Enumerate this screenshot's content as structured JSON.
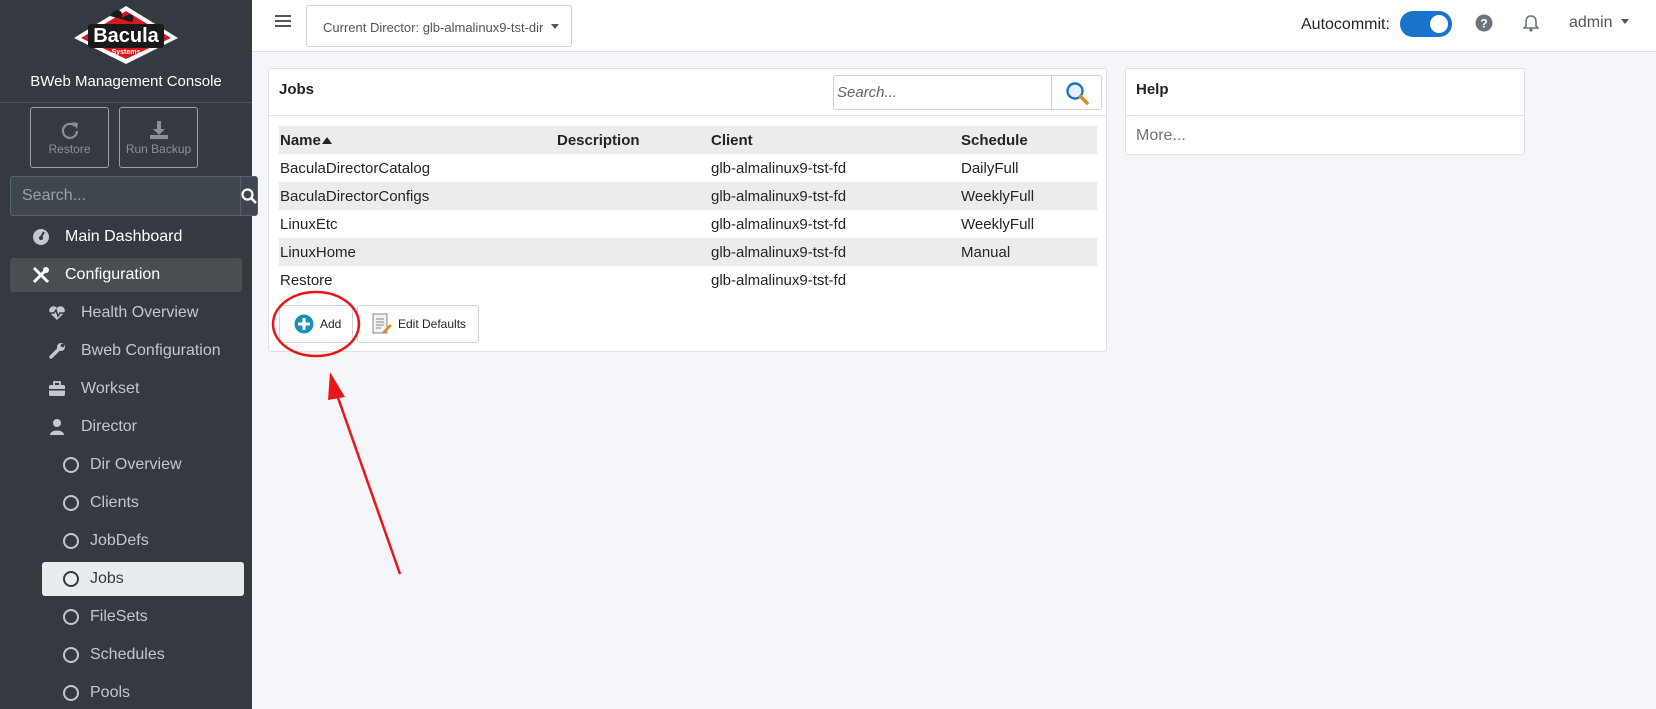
{
  "sidebar": {
    "logo_text": "Bacula",
    "logo_subtext": "Systems",
    "brand_title": "BWeb Management Console",
    "actions": [
      {
        "label": "Restore",
        "icon": "redo-icon"
      },
      {
        "label": "Run Backup",
        "icon": "download-icon"
      }
    ],
    "search_placeholder": "Search...",
    "nav": {
      "main_dashboard": "Main Dashboard",
      "configuration": "Configuration",
      "health_overview": "Health Overview",
      "bweb_configuration": "Bweb Configuration",
      "workset": "Workset",
      "director": "Director",
      "dir_overview": "Dir Overview",
      "clients": "Clients",
      "jobdefs": "JobDefs",
      "jobs": "Jobs",
      "filesets": "FileSets",
      "schedules": "Schedules",
      "pools": "Pools"
    }
  },
  "header": {
    "director_label": "Current Director: glb-almalinux9-tst-dir",
    "autocommit_label": "Autocommit:",
    "autocommit_on": true,
    "user": "admin"
  },
  "jobs_card": {
    "title": "Jobs",
    "search_placeholder": "Search...",
    "columns": [
      "Name",
      "Description",
      "Client",
      "Schedule"
    ],
    "rows": [
      {
        "name": "BaculaDirectorCatalog",
        "description": "",
        "client": "glb-almalinux9-tst-fd",
        "schedule": "DailyFull"
      },
      {
        "name": "BaculaDirectorConfigs",
        "description": "",
        "client": "glb-almalinux9-tst-fd",
        "schedule": "WeeklyFull"
      },
      {
        "name": "LinuxEtc",
        "description": "",
        "client": "glb-almalinux9-tst-fd",
        "schedule": "WeeklyFull"
      },
      {
        "name": "LinuxHome",
        "description": "",
        "client": "glb-almalinux9-tst-fd",
        "schedule": "Manual"
      },
      {
        "name": "Restore",
        "description": "",
        "client": "glb-almalinux9-tst-fd",
        "schedule": ""
      }
    ],
    "add_label": "Add",
    "edit_defaults_label": "Edit Defaults"
  },
  "help_card": {
    "title": "Help",
    "more_label": "More..."
  },
  "colors": {
    "sidebar_bg": "#343a40",
    "accent": "#1a73c8",
    "annotation": "#e8161b"
  }
}
